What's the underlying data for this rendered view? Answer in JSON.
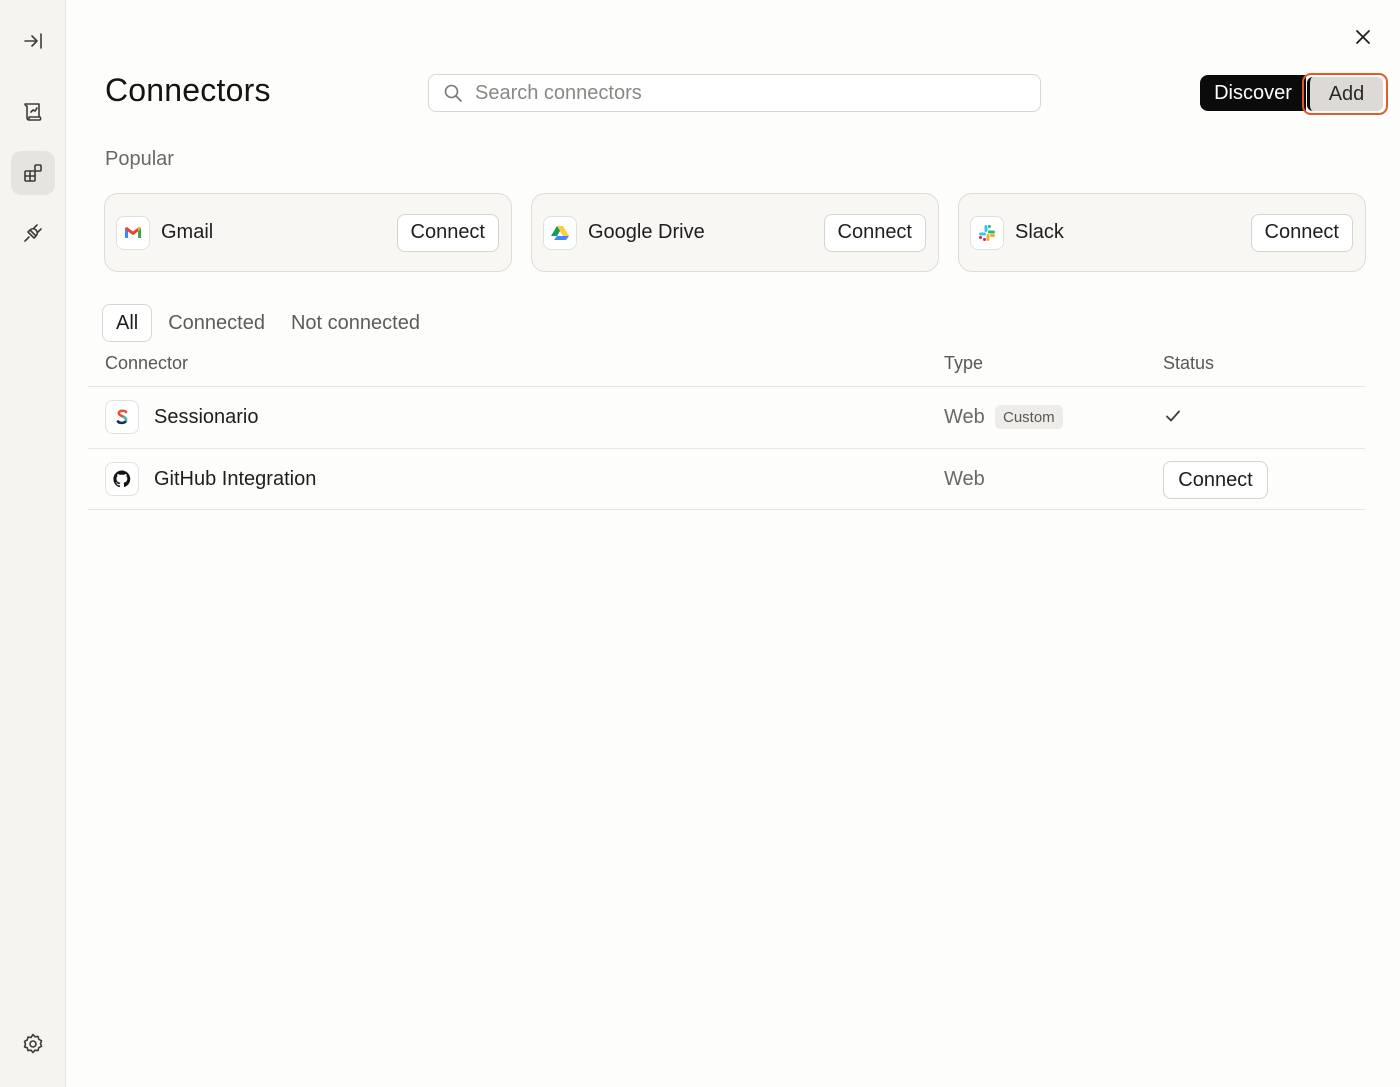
{
  "sidebar": {
    "items": [
      {
        "icon": "collapse-sidebar-icon"
      },
      {
        "icon": "scroll-icon"
      },
      {
        "icon": "connectors-icon"
      },
      {
        "icon": "plug-icon"
      }
    ],
    "settings_icon": "gear-icon"
  },
  "header": {
    "title": "Connectors",
    "search_placeholder": "Search connectors",
    "discover_label": "Discover",
    "add_label": "Add"
  },
  "popular": {
    "label": "Popular",
    "cards": [
      {
        "name": "Gmail",
        "button": "Connect"
      },
      {
        "name": "Google Drive",
        "button": "Connect"
      },
      {
        "name": "Slack",
        "button": "Connect"
      }
    ]
  },
  "filters": {
    "tabs": [
      "All",
      "Connected",
      "Not connected"
    ],
    "active": "All"
  },
  "table": {
    "columns": [
      "Connector",
      "Type",
      "Status"
    ],
    "rows": [
      {
        "name": "Sessionario",
        "type": "Web",
        "badge": "Custom",
        "status": "connected"
      },
      {
        "name": "GitHub Integration",
        "type": "Web",
        "status_button": "Connect"
      }
    ]
  },
  "colors": {
    "accent_outline": "#e35a2b",
    "discover_bg": "#0b0b0b"
  }
}
